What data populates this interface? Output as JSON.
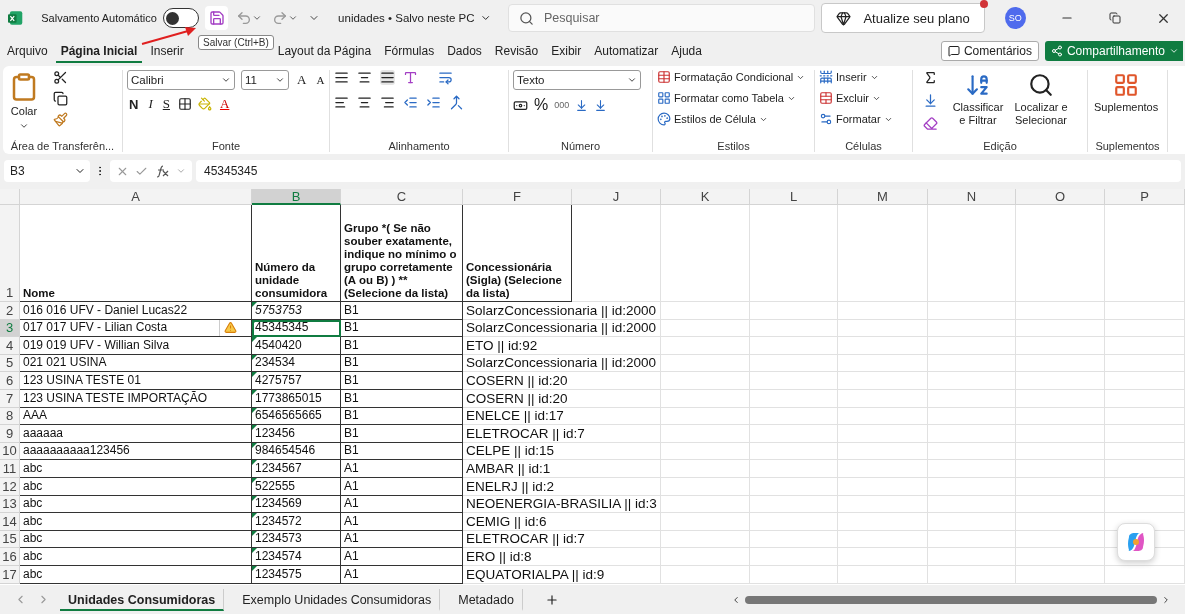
{
  "title_bar": {
    "autosave_label": "Salvamento Automático",
    "autosave_on": false,
    "file_title": "unidades • Salvo neste PC",
    "search_placeholder": "Pesquisar",
    "upgrade_button": "Atualize seu plano",
    "avatar": "SO"
  },
  "tooltip": "Salvar (Ctrl+B)",
  "menu_tabs": [
    {
      "label": "Arquivo",
      "selected": false
    },
    {
      "label": "Página Inicial",
      "selected": true
    },
    {
      "label": "Inserir",
      "selected": false
    },
    {
      "label": "Layout da Página",
      "selected": false
    },
    {
      "label": "Fórmulas",
      "selected": false
    },
    {
      "label": "Dados",
      "selected": false
    },
    {
      "label": "Revisão",
      "selected": false
    },
    {
      "label": "Exibir",
      "selected": false
    },
    {
      "label": "Automatizar",
      "selected": false
    },
    {
      "label": "Ajuda",
      "selected": false
    }
  ],
  "comments_button": "Comentários",
  "share_button": "Compartilhamento",
  "ribbon": {
    "clipboard": {
      "label": "Área de Transferên...",
      "paste": "Colar"
    },
    "font": {
      "label": "Fonte",
      "font_name": "Calibri",
      "font_size": "11",
      "grow": "A",
      "shrink": "A",
      "bold": "N",
      "italic": "I",
      "underline": "S",
      "color_letter": "A"
    },
    "alignment": {
      "label": "Alinhamento"
    },
    "number": {
      "label": "Número",
      "format": "Texto",
      "percent": "%",
      "thousands": "000"
    },
    "styles": {
      "label": "Estilos",
      "items": [
        "Formatação Condicional",
        "Formatar como Tabela",
        "Estilos de Célula"
      ]
    },
    "cells": {
      "label": "Células",
      "items": [
        "Inserir",
        "Excluir",
        "Formatar"
      ]
    },
    "editing": {
      "label": "Edição",
      "sort": "Classificar e Filtrar",
      "find": "Localizar e Selecionar"
    },
    "addins": {
      "label": "Suplementos",
      "button": "Suplementos"
    }
  },
  "formula_bar": {
    "name_box": "B3",
    "value": "45345345"
  },
  "sheet": {
    "columns": [
      {
        "label": "A",
        "selected": false
      },
      {
        "label": "B",
        "selected": true
      },
      {
        "label": "C",
        "selected": false
      },
      {
        "label": "F",
        "selected": false
      },
      {
        "label": "J",
        "selected": false
      },
      {
        "label": "K",
        "selected": false
      },
      {
        "label": "L",
        "selected": false
      },
      {
        "label": "M",
        "selected": false
      },
      {
        "label": "N",
        "selected": false
      },
      {
        "label": "O",
        "selected": false
      },
      {
        "label": "P",
        "selected": false
      }
    ],
    "header_row": {
      "number": "1",
      "cells": [
        "Nome",
        "Número da unidade consumidora",
        "Grupo *( Se não souber exatamente, indique no mínimo o grupo corretamente (A ou B) ) **(Selecione da lista)",
        "Concessionária (Sigla)  (Selecione da lista)"
      ]
    },
    "rows": [
      {
        "number": "2",
        "cells": [
          "016 016 UFV - Daniel Lucas22",
          "5753753",
          "B1",
          "SolarzConcessionaria || id:2000"
        ],
        "selected": false,
        "warning": false,
        "italic": true
      },
      {
        "number": "3",
        "cells": [
          "017 017 UFV - Lilian Costa",
          "45345345",
          "B1",
          "SolarzConcessionaria || id:2000"
        ],
        "selected": true,
        "warning": true,
        "italic": false
      },
      {
        "number": "4",
        "cells": [
          "019 019 UFV - Willian Silva",
          "4540420",
          "B1",
          "ETO || id:92"
        ],
        "selected": false,
        "warning": false,
        "italic": false
      },
      {
        "number": "5",
        "cells": [
          "021 021 USINA",
          "234534",
          "B1",
          "SolarzConcessionaria || id:2000"
        ],
        "selected": false,
        "warning": false,
        "italic": false
      },
      {
        "number": "6",
        "cells": [
          "123 USINA TESTE 01",
          "4275757",
          "B1",
          "COSERN || id:20"
        ],
        "selected": false,
        "warning": false,
        "italic": false
      },
      {
        "number": "7",
        "cells": [
          "123 USINA TESTE IMPORTAÇÃO",
          "1773865015",
          "B1",
          "COSERN || id:20"
        ],
        "selected": false,
        "warning": false,
        "italic": false
      },
      {
        "number": "8",
        "cells": [
          "AAA",
          "6546565665",
          "B1",
          "ENELCE || id:17"
        ],
        "selected": false,
        "warning": false,
        "italic": false
      },
      {
        "number": "9",
        "cells": [
          "aaaaaa",
          "123456",
          "B1",
          "ELETROCAR || id:7"
        ],
        "selected": false,
        "warning": false,
        "italic": false
      },
      {
        "number": "10",
        "cells": [
          "aaaaaaaaaa123456",
          "984654546",
          "B1",
          "CELPE || id:15"
        ],
        "selected": false,
        "warning": false,
        "italic": false
      },
      {
        "number": "11",
        "cells": [
          "abc",
          "1234567",
          "A1",
          "AMBAR || id:1"
        ],
        "selected": false,
        "warning": false,
        "italic": false
      },
      {
        "number": "12",
        "cells": [
          "abc",
          "522555",
          "A1",
          "ENELRJ || id:2"
        ],
        "selected": false,
        "warning": false,
        "italic": false
      },
      {
        "number": "13",
        "cells": [
          "abc",
          "1234569",
          "A1",
          "NEOENERGIA-BRASILIA || id:3"
        ],
        "selected": false,
        "warning": false,
        "italic": false
      },
      {
        "number": "14",
        "cells": [
          "abc",
          "1234572",
          "A1",
          "CEMIG || id:6"
        ],
        "selected": false,
        "warning": false,
        "italic": false
      },
      {
        "number": "15",
        "cells": [
          "abc",
          "1234573",
          "A1",
          "ELETROCAR || id:7"
        ],
        "selected": false,
        "warning": false,
        "italic": false
      },
      {
        "number": "16",
        "cells": [
          "abc",
          "1234574",
          "A1",
          "ERO || id:8"
        ],
        "selected": false,
        "warning": false,
        "italic": false
      },
      {
        "number": "17",
        "cells": [
          "abc",
          "1234575",
          "A1",
          "EQUATORIALPA || id:9"
        ],
        "selected": false,
        "warning": false,
        "italic": false
      }
    ]
  },
  "sheet_tabs": [
    {
      "label": "Unidades Consumidoras",
      "selected": true
    },
    {
      "label": "Exemplo Unidades Consumidoras",
      "selected": false
    },
    {
      "label": "Metadado",
      "selected": false
    }
  ]
}
